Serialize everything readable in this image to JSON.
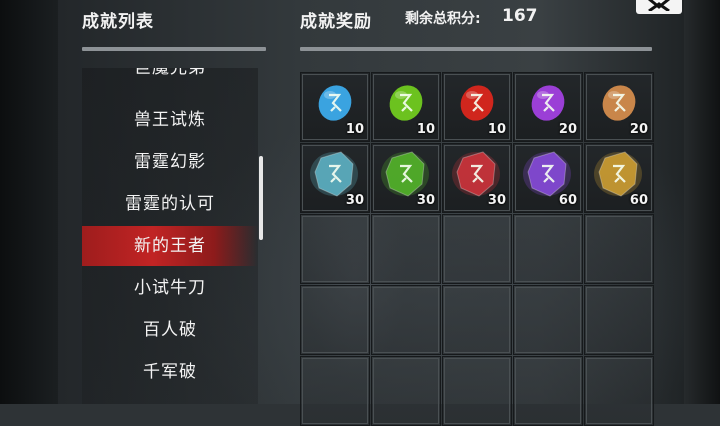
{
  "header": {
    "list_title": "成就列表",
    "rewards_title": "成就奖励",
    "score_label": "剩余总积分:",
    "score_value": "167"
  },
  "achievements": [
    {
      "label": "巨魔兄弟"
    },
    {
      "label": "兽王试炼"
    },
    {
      "label": "雷霆幻影"
    },
    {
      "label": "雷霆的认可"
    },
    {
      "label": "新的王者",
      "selected": true
    },
    {
      "label": "小试牛刀"
    },
    {
      "label": "百人破"
    },
    {
      "label": "千军破"
    }
  ],
  "rewards": [
    {
      "icon": "blue-rune-stone-icon",
      "count": "10",
      "color": "#3aa3e0"
    },
    {
      "icon": "green-rune-stone-icon",
      "count": "10",
      "color": "#6cc21f"
    },
    {
      "icon": "red-rune-stone-icon",
      "count": "10",
      "color": "#d0261d"
    },
    {
      "icon": "purple-rune-stone-icon",
      "count": "20",
      "color": "#9b3fd6"
    },
    {
      "icon": "orange-rune-stone-icon",
      "count": "20",
      "color": "#c9864a"
    },
    {
      "icon": "cyan-crystal-rune-icon",
      "count": "30",
      "color": "#5fb6c9"
    },
    {
      "icon": "green-crystal-rune-icon",
      "count": "30",
      "color": "#55b82a"
    },
    {
      "icon": "red-crystal-rune-icon",
      "count": "30",
      "color": "#d3343c"
    },
    {
      "icon": "purple-crystal-rune-icon",
      "count": "60",
      "color": "#8a4ce0"
    },
    {
      "icon": "gold-crystal-rune-icon",
      "count": "60",
      "color": "#d3a233"
    }
  ],
  "colors": {
    "selected_row": "#c12424",
    "header_line": "#8d9296"
  }
}
